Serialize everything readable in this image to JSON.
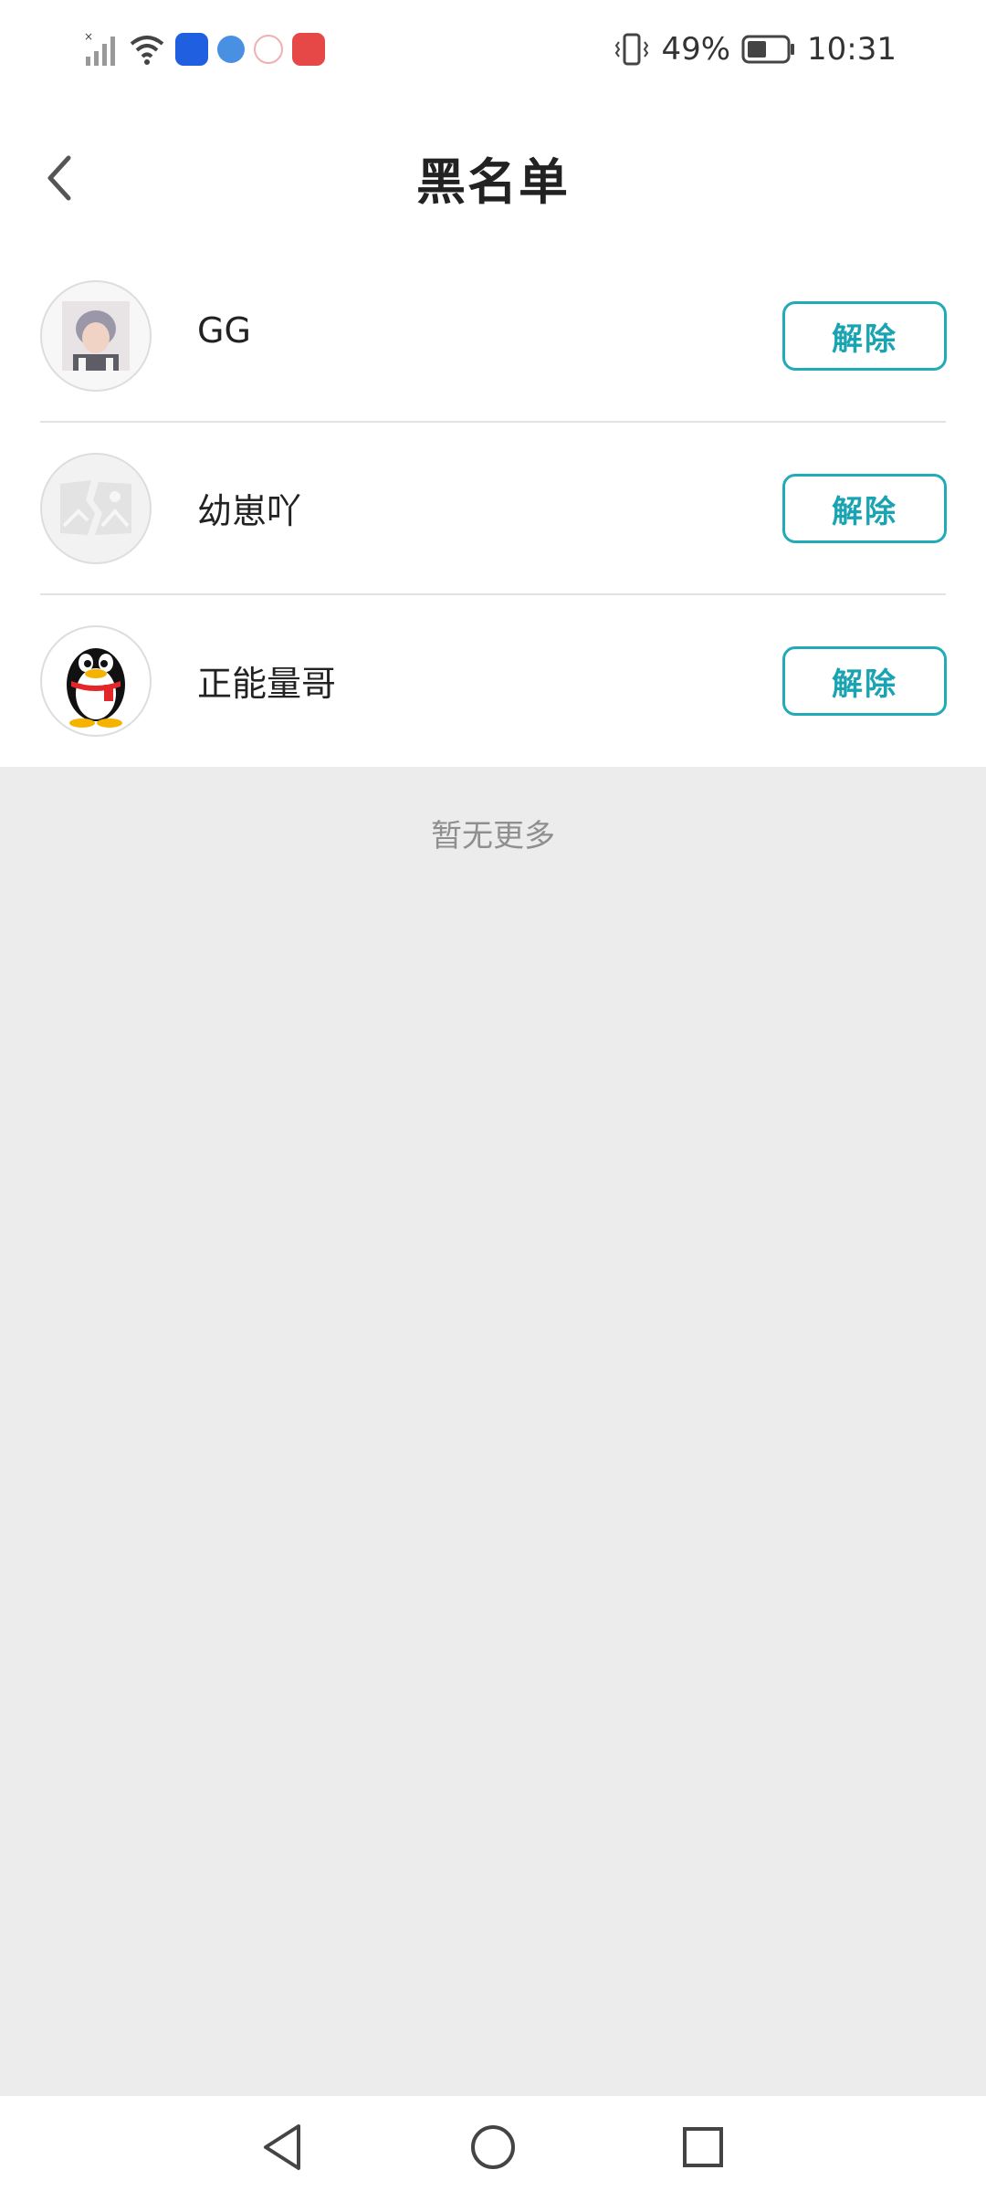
{
  "status_bar": {
    "battery_percent": "49%",
    "time": "10:31",
    "battery_level": 0.49
  },
  "header": {
    "title": "黑名单"
  },
  "blocked_users": [
    {
      "name": "GG",
      "action_label": "解除",
      "avatar": "user-photo"
    },
    {
      "name": "幼崽吖",
      "action_label": "解除",
      "avatar": "broken-image"
    },
    {
      "name": "正能量哥",
      "action_label": "解除",
      "avatar": "penguin-avatar"
    }
  ],
  "footer": {
    "no_more_text": "暂无更多"
  },
  "colors": {
    "accent": "#21aab7",
    "background": "#ececec",
    "surface": "#ffffff"
  }
}
